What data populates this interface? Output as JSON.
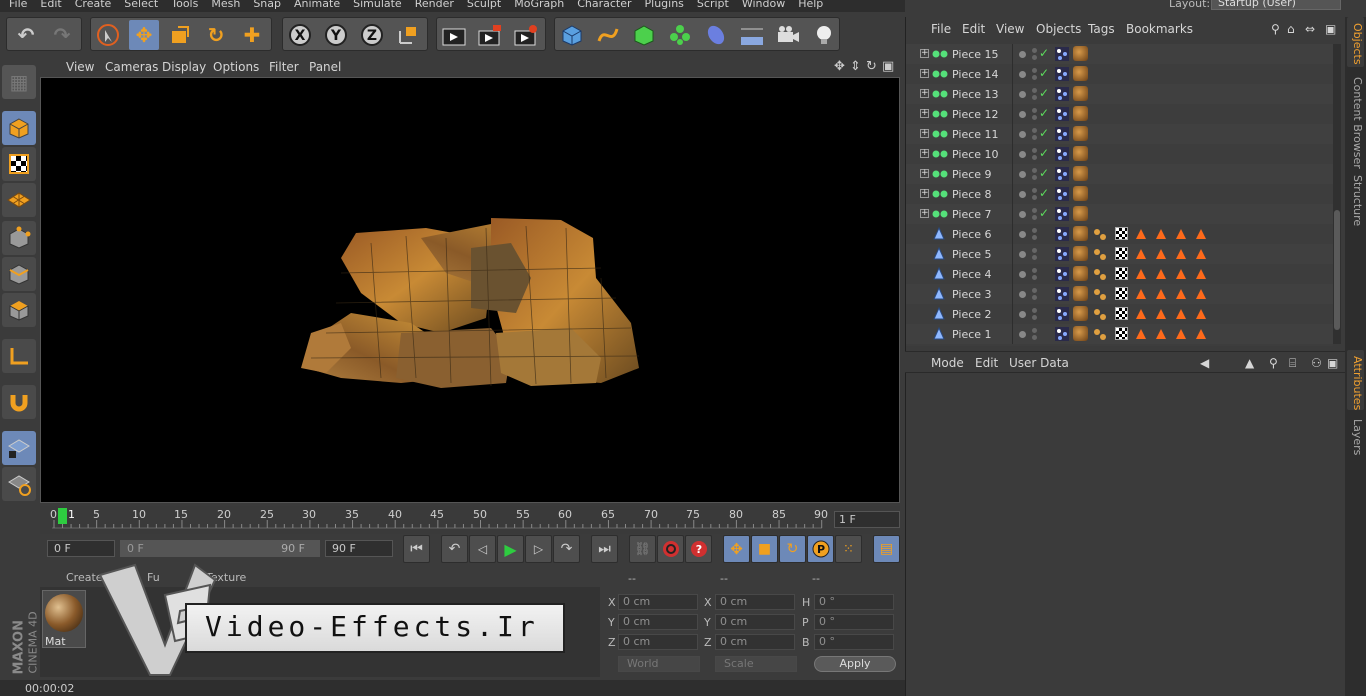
{
  "menubar": {
    "items": [
      "File",
      "Edit",
      "Create",
      "Select",
      "Tools",
      "Mesh",
      "Snap",
      "Animate",
      "Simulate",
      "Render",
      "Sculpt",
      "MoGraph",
      "Character",
      "Plugins",
      "Script",
      "Window",
      "Help"
    ],
    "layout_label": "Layout:",
    "layout_value": "Startup (User)"
  },
  "viewport": {
    "menu": [
      "View",
      "Cameras",
      "Display",
      "Options",
      "Filter",
      "Panel"
    ]
  },
  "timeline": {
    "ticks": [
      "0",
      "5",
      "10",
      "15",
      "20",
      "25",
      "30",
      "35",
      "40",
      "45",
      "50",
      "55",
      "60",
      "65",
      "70",
      "75",
      "80",
      "85",
      "90"
    ],
    "current_marker": "1",
    "frame_field": "1 F",
    "start_field": "0 F",
    "range_start": "0 F",
    "range_end": "90 F",
    "end_field": "90 F"
  },
  "material_manager": {
    "menu": [
      "Create",
      "Fu",
      "Texture"
    ],
    "material_name": "Mat"
  },
  "coordinates": {
    "headers": [
      "--",
      "--",
      "--"
    ],
    "pos_labels": [
      "X",
      "Y",
      "Z"
    ],
    "pos_values": [
      "0 cm",
      "0 cm",
      "0 cm"
    ],
    "size_labels": [
      "X",
      "Y",
      "Z"
    ],
    "size_values": [
      "0 cm",
      "0 cm",
      "0 cm"
    ],
    "rot_labels": [
      "H",
      "P",
      "B"
    ],
    "rot_values": [
      "0 °",
      "0 °",
      "0 °"
    ],
    "mode_world": "World",
    "mode_scale": "Scale",
    "apply": "Apply"
  },
  "status": {
    "time": "00:00:02"
  },
  "object_manager": {
    "menu": [
      "File",
      "Edit",
      "View",
      "Objects",
      "Tags",
      "Bookmarks"
    ],
    "objects": [
      {
        "name": "Piece 15",
        "type": "null"
      },
      {
        "name": "Piece 14",
        "type": "null"
      },
      {
        "name": "Piece 13",
        "type": "null"
      },
      {
        "name": "Piece 12",
        "type": "null"
      },
      {
        "name": "Piece 11",
        "type": "null"
      },
      {
        "name": "Piece 10",
        "type": "null"
      },
      {
        "name": "Piece 9",
        "type": "null"
      },
      {
        "name": "Piece 8",
        "type": "null"
      },
      {
        "name": "Piece 7",
        "type": "null"
      },
      {
        "name": "Piece 6",
        "type": "poly"
      },
      {
        "name": "Piece 5",
        "type": "poly"
      },
      {
        "name": "Piece 4",
        "type": "poly"
      },
      {
        "name": "Piece 3",
        "type": "poly"
      },
      {
        "name": "Piece 2",
        "type": "poly"
      },
      {
        "name": "Piece 1",
        "type": "poly"
      }
    ]
  },
  "attribute_manager": {
    "menu": [
      "Mode",
      "Edit",
      "User Data"
    ]
  },
  "side_tabs": {
    "top": [
      "Objects",
      "Content Browser",
      "Structure"
    ],
    "bottom": [
      "Attributes",
      "Layers"
    ]
  },
  "watermark": {
    "text": "Video-Effects.Ir",
    "brand_line1": "MAXON",
    "brand_line2": "CINEMA 4D"
  },
  "colors": {
    "accent_blue": "#6d89b8",
    "tag_orange": "#ff6a1a",
    "play_green": "#2ecc40",
    "check_green": "#5ddc5d"
  }
}
